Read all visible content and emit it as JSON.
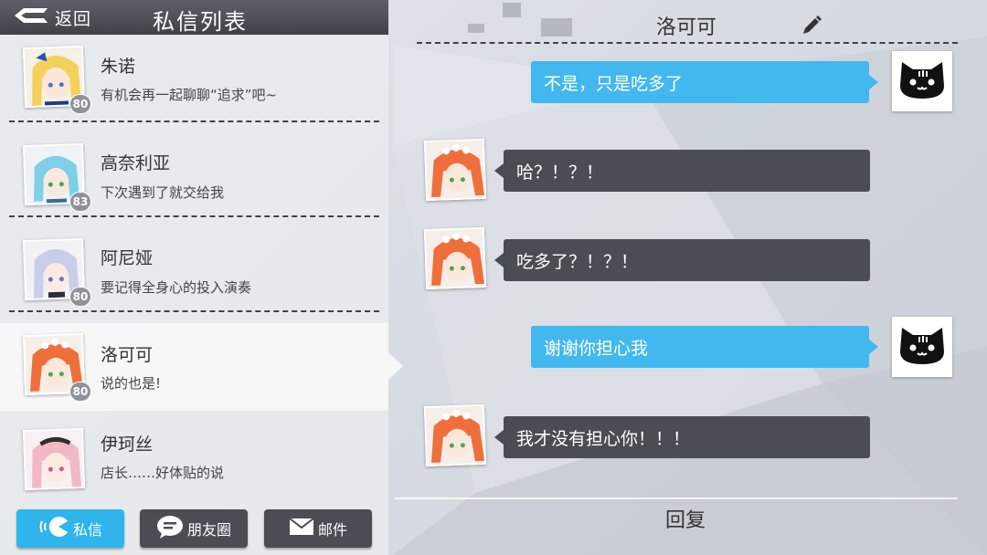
{
  "header": {
    "back_label": "返回",
    "list_title": "私信列表"
  },
  "contacts": [
    {
      "name": "朱诺",
      "message": "有机会再一起聊聊“追求”吧~",
      "level": "80",
      "hair": "#f3d15a",
      "accent": "#1e3a8c",
      "skin": "#fbe6d8"
    },
    {
      "name": "高奈利亚",
      "message": "下次遇到了就交给我",
      "level": "83",
      "hair": "#7fd0e6",
      "accent": "#3a6b9c",
      "skin": "#fbe8dc"
    },
    {
      "name": "阿尼娅",
      "message": "要记得全身心的投入演奏",
      "level": "80",
      "hair": "#c9cee8",
      "accent": "#2b2b3a",
      "skin": "#fbeae2"
    },
    {
      "name": "洛可可",
      "message": "说的也是!",
      "level": "80",
      "hair": "#ef6f3c",
      "accent": "#ffffff",
      "skin": "#fce7db"
    },
    {
      "name": "伊珂丝",
      "message": "店长……好体贴的说",
      "level": "",
      "hair": "#f2b8c6",
      "accent": "#2e2e2e",
      "skin": "#fdeae2"
    }
  ],
  "tabs": [
    {
      "label": "私信",
      "icon": "pacman-chat-icon",
      "active": true
    },
    {
      "label": "朋友圈",
      "icon": "speech-bubble-icon",
      "active": false
    },
    {
      "label": "邮件",
      "icon": "envelope-icon",
      "active": false
    }
  ],
  "chat": {
    "title": "洛可可",
    "edit_icon": "pencil-icon",
    "messages": [
      {
        "from": "me",
        "text": "不是，只是吃多了"
      },
      {
        "from": "them",
        "text": "哈？！？！"
      },
      {
        "from": "them",
        "text": "吃多了？！？！"
      },
      {
        "from": "me",
        "text": "谢谢你担心我"
      },
      {
        "from": "them",
        "text": "我才没有担心你！！！"
      }
    ],
    "reply_label": "回复"
  },
  "colors": {
    "accent_blue": "#42b8ee",
    "dark_bubble": "#4a4d53",
    "header_dark": "#4a4d53"
  }
}
